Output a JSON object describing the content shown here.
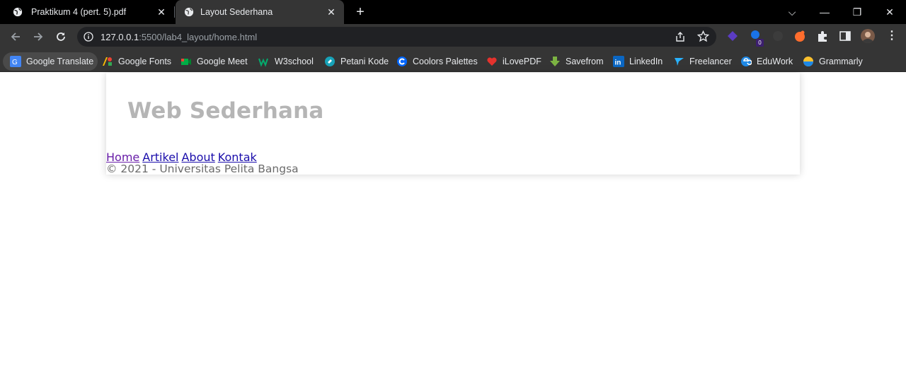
{
  "browser": {
    "tabs": [
      {
        "title": "Praktikum 4 (pert. 5).pdf",
        "active": false
      },
      {
        "title": "Layout Sederhana",
        "active": true
      }
    ],
    "new_tab_label": "+",
    "window_controls": {
      "chevron": "⌵",
      "minimize": "—",
      "restore": "❐",
      "close": "✕"
    },
    "address": {
      "host": "127.0.0.1",
      "rest": ":5500/lab4_layout/home.html"
    },
    "extension_badge": "0",
    "bookmarks": [
      {
        "label": "Google Translate",
        "icon": "google-translate-icon",
        "color": "#4285f4"
      },
      {
        "label": "Google Fonts",
        "icon": "google-fonts-icon",
        "color": "#fbbc04"
      },
      {
        "label": "Google Meet",
        "icon": "google-meet-icon",
        "color": "#00ac47"
      },
      {
        "label": "W3school",
        "icon": "w3school-icon",
        "color": "#04aa6d"
      },
      {
        "label": "Petani Kode",
        "icon": "petani-kode-icon",
        "color": "#17a2b8"
      },
      {
        "label": "Coolors Palettes",
        "icon": "coolors-icon",
        "color": "#0066ff"
      },
      {
        "label": "iLovePDF",
        "icon": "heart-icon",
        "color": "#e5322d"
      },
      {
        "label": "Savefrom",
        "icon": "download-arrow-icon",
        "color": "#7cb342"
      },
      {
        "label": "LinkedIn",
        "icon": "linkedin-icon",
        "color": "#0a66c2"
      },
      {
        "label": "Freelancer",
        "icon": "freelancer-icon",
        "color": "#29b2fe"
      },
      {
        "label": "EduWork",
        "icon": "eduwork-icon",
        "color": "#1e88e5"
      },
      {
        "label": "Grammarly",
        "icon": "grammarly-icon",
        "color": "#fbc02d"
      }
    ]
  },
  "page": {
    "site_title": "Web Sederhana",
    "nav": [
      "Home",
      "Artikel",
      "About",
      "Kontak"
    ],
    "footer": "© 2021 - Universitas Pelita Bangsa",
    "colors": {
      "title": "#b5b5b5",
      "link": "#1a0dab",
      "visited": "#681da8",
      "footer": "#6b6b6b"
    }
  }
}
